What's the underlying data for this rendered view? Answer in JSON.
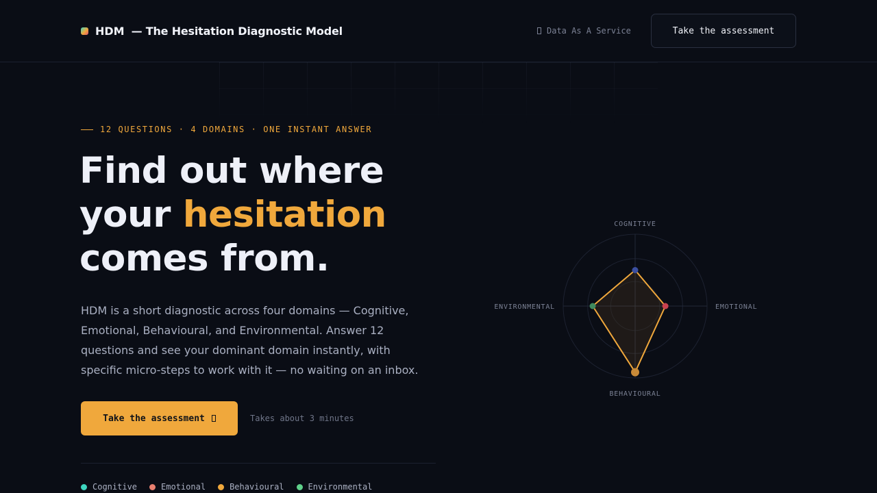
{
  "header": {
    "brand_name": "HDM",
    "brand_tagline": "— The Hesitation Diagnostic Model",
    "daas_label": "Data As A Service",
    "cta_label": "Take the assessment"
  },
  "hero": {
    "eyebrow": "12 QUESTIONS · 4 DOMAINS · ONE INSTANT ANSWER",
    "headline_line1": "Find out where",
    "headline_line2_prefix": "your ",
    "headline_accent": "hesitation",
    "headline_line3": "comes from.",
    "description": "HDM is a short diagnostic across four domains — Cognitive, Emotional, Behavioural, and Environmental. Answer 12 questions and see your dominant domain instantly, with specific micro-steps to work with it — no waiting on an inbox.",
    "cta_label": "Take the assessment",
    "cta_note": "Takes about 3 minutes"
  },
  "legend": [
    {
      "label": "Cognitive",
      "color": "#3ed6c0"
    },
    {
      "label": "Emotional",
      "color": "#e98070"
    },
    {
      "label": "Behavioural",
      "color": "#f0a83c"
    },
    {
      "label": "Environmental",
      "color": "#5fd08a"
    }
  ],
  "radar": {
    "axes": [
      {
        "label": "COGNITIVE",
        "value": 0.5,
        "point_color": "#3b4fa0"
      },
      {
        "label": "EMOTIONAL",
        "value": 0.42,
        "point_color": "#c8414f"
      },
      {
        "label": "BEHAVIOURAL",
        "value": 0.92,
        "point_color": "#c88a38"
      },
      {
        "label": "ENVIRONMENTAL",
        "value": 0.59,
        "point_color": "#3f8a5e"
      }
    ],
    "stroke_color": "#f0a83c"
  }
}
